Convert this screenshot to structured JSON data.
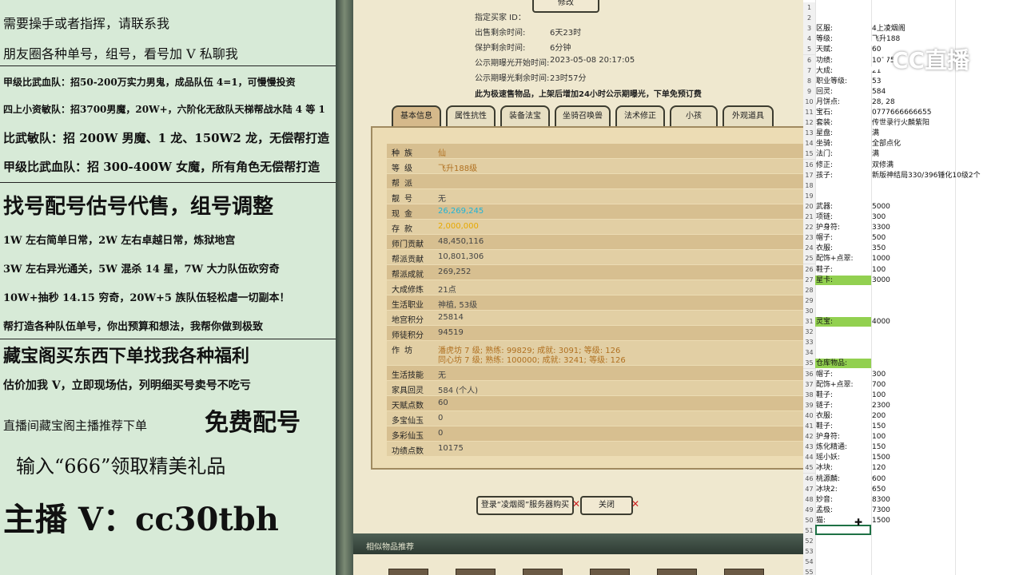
{
  "left_panel": {
    "lines": [
      "需要操手或者指挥，请联系我",
      "朋友圈各种单号，组号，看号加 V 私聊我",
      "甲级比武血队：招50-200万实力男鬼，成品队伍 4=1，可慢慢投资",
      "四上小资敏队：招3700男魔，20W+，六阶化无敌队天梯帮战水陆 4 等 1",
      "比武敏队：招 200W 男魔、1 龙、150W2 龙，无偿帮打造",
      "甲级比武血队：招 300-400W 女魔，所有角色无偿帮打造",
      "找号配号估号代售，组号调整",
      "1W 左右简单日常，2W 左右卓越日常，炼狱地宫",
      "3W 左右异光通关，5W 混杀 14 星，7W 大力队伍砍穷奇",
      "10W+抽秒 14.15 穷奇，20W+5 族队伍轻松虐一切副本！",
      "帮打造各种队伍单号，你出预算和想法，我帮你做到极致",
      "藏宝阁买东西下单找我各种福利",
      "估价加我 V，立即现场估，列明细买号卖号不吃亏",
      "直播间藏宝阁主播推荐下单",
      "免费配号",
      "输入“666”领取精美礼品",
      "主播 V：cc30tbh"
    ]
  },
  "game": {
    "header": {
      "designated_buyer": "指定买家 ID：",
      "sell_time_label": "出售剩余时间:",
      "sell_time_value": "6天23时",
      "protect_label": "保护剩余时间:",
      "protect_value": "6分钟",
      "public_start_label": "公示期曝光开始时间:",
      "public_start_value": "2023-05-08 20:17:05",
      "public_remain_label": "公示期曝光剩余时间:",
      "public_remain_value": "23时57分",
      "notice": "此为极速售物品，上架后增加24小时公示期曝光，下单免预订费",
      "top_button": "修改"
    },
    "tabs": [
      "基本信息",
      "属性抗性",
      "装备法宝",
      "坐骑召唤兽",
      "法术修正",
      "小孩",
      "外观道具"
    ],
    "info_rows": [
      {
        "k": "种族",
        "v": "仙"
      },
      {
        "k": "等级",
        "v": "飞升188级"
      },
      {
        "k": "帮派",
        "v": ""
      },
      {
        "k": "靓号",
        "v": "无"
      },
      {
        "k": "现金",
        "v": "26,269,245"
      },
      {
        "k": "存款",
        "v": "2,000,000"
      },
      {
        "k": "师门贡献",
        "v": "48,450,116"
      },
      {
        "k": "帮派贡献",
        "v": "10,801,306"
      },
      {
        "k": "帮派成就",
        "v": "269,252"
      },
      {
        "k": "大成修炼",
        "v": "21点"
      },
      {
        "k": "生活职业",
        "v": "神植, 53级"
      },
      {
        "k": "地宫积分",
        "v": "25814"
      },
      {
        "k": "师徒积分",
        "v": "94519"
      },
      {
        "k": "作坊",
        "v": "潘虎坊 7 级; 熟练: 99829; 成就: 3091; 等级: 126",
        "v2": "同心坊 7 级; 熟练: 100000; 成就: 3241; 等级: 126"
      },
      {
        "k": "生活技能",
        "v": "无"
      },
      {
        "k": "家具回灵",
        "v": "584 (个人)"
      },
      {
        "k": "天赋点数",
        "v": "60"
      },
      {
        "k": "多宝仙玉",
        "v": "0"
      },
      {
        "k": "多彩仙玉",
        "v": "0"
      },
      {
        "k": "功绩点数",
        "v": "10175"
      }
    ],
    "buttons": {
      "buy": "登录“凌烟阁”服务器购买",
      "close": "关闭"
    },
    "bottom_bar": "相似物品推荐"
  },
  "sheet": {
    "logo": "CC直播",
    "rows": [
      {
        "n": "1",
        "b": "",
        "c": ""
      },
      {
        "n": "2",
        "b": "",
        "c": ""
      },
      {
        "n": "3",
        "b": "区服:",
        "c": "4上凌烟阁"
      },
      {
        "n": "4",
        "b": "等级:",
        "c": "飞升188"
      },
      {
        "n": "5",
        "b": "天赋:",
        "c": "60"
      },
      {
        "n": "6",
        "b": "功绩:",
        "c": "10175"
      },
      {
        "n": "7",
        "b": "大成:",
        "c": "21"
      },
      {
        "n": "8",
        "b": "职业等级:",
        "c": "53"
      },
      {
        "n": "9",
        "b": "回灵:",
        "c": "584"
      },
      {
        "n": "10",
        "b": "月饼点:",
        "c": "28, 28"
      },
      {
        "n": "11",
        "b": "宝石:",
        "c": "0777666666655"
      },
      {
        "n": "12",
        "b": "套装:",
        "c": "传世录行火麟紫阳"
      },
      {
        "n": "13",
        "b": "星盘:",
        "c": "满"
      },
      {
        "n": "14",
        "b": "坐骑:",
        "c": "全部点化"
      },
      {
        "n": "15",
        "b": "法门:",
        "c": "满"
      },
      {
        "n": "16",
        "b": "修正:",
        "c": "双修满"
      },
      {
        "n": "17",
        "b": "孩子:",
        "c": "新版神结局330/396锤化10级2个"
      },
      {
        "n": "18",
        "b": "",
        "c": ""
      },
      {
        "n": "19",
        "b": "",
        "c": ""
      },
      {
        "n": "20",
        "b": "武器:",
        "c": "5000"
      },
      {
        "n": "21",
        "b": "项链:",
        "c": "300"
      },
      {
        "n": "22",
        "b": "护身符:",
        "c": "3300"
      },
      {
        "n": "23",
        "b": "帽子:",
        "c": "500"
      },
      {
        "n": "24",
        "b": "衣服:",
        "c": "350"
      },
      {
        "n": "25",
        "b": "配饰+点翠:",
        "c": "1000"
      },
      {
        "n": "26",
        "b": "鞋子:",
        "c": "100"
      },
      {
        "n": "27",
        "b": "星卡:",
        "c": "3000",
        "hl": true
      },
      {
        "n": "28",
        "b": "",
        "c": ""
      },
      {
        "n": "29",
        "b": "",
        "c": ""
      },
      {
        "n": "30",
        "b": "",
        "c": ""
      },
      {
        "n": "31",
        "b": "灵宝:",
        "c": "4000",
        "hl": true
      },
      {
        "n": "32",
        "b": "",
        "c": ""
      },
      {
        "n": "33",
        "b": "",
        "c": ""
      },
      {
        "n": "34",
        "b": "",
        "c": ""
      },
      {
        "n": "35",
        "b": "仓库物品:",
        "c": "",
        "hl": true
      },
      {
        "n": "36",
        "b": "帽子:",
        "c": "300"
      },
      {
        "n": "37",
        "b": "配饰+点翠:",
        "c": "700"
      },
      {
        "n": "38",
        "b": "鞋子:",
        "c": "100"
      },
      {
        "n": "39",
        "b": "链子:",
        "c": "2300"
      },
      {
        "n": "40",
        "b": "衣服:",
        "c": "200"
      },
      {
        "n": "41",
        "b": "鞋子:",
        "c": "150"
      },
      {
        "n": "42",
        "b": "护身符:",
        "c": "100"
      },
      {
        "n": "43",
        "b": "炼化精通:",
        "c": "150"
      },
      {
        "n": "44",
        "b": "瑶小妖:",
        "c": "1500"
      },
      {
        "n": "45",
        "b": "冰块:",
        "c": "120"
      },
      {
        "n": "46",
        "b": "桃源麟:",
        "c": "600"
      },
      {
        "n": "47",
        "b": "冰块2:",
        "c": "650"
      },
      {
        "n": "48",
        "b": "妙音:",
        "c": "8300"
      },
      {
        "n": "49",
        "b": "孟极:",
        "c": "7300"
      },
      {
        "n": "50",
        "b": "猫:",
        "c": "1500"
      },
      {
        "n": "51",
        "b": "",
        "c": ""
      },
      {
        "n": "52",
        "b": "",
        "c": ""
      },
      {
        "n": "53",
        "b": "",
        "c": ""
      },
      {
        "n": "54",
        "b": "",
        "c": ""
      },
      {
        "n": "55",
        "b": "",
        "c": ""
      }
    ]
  }
}
